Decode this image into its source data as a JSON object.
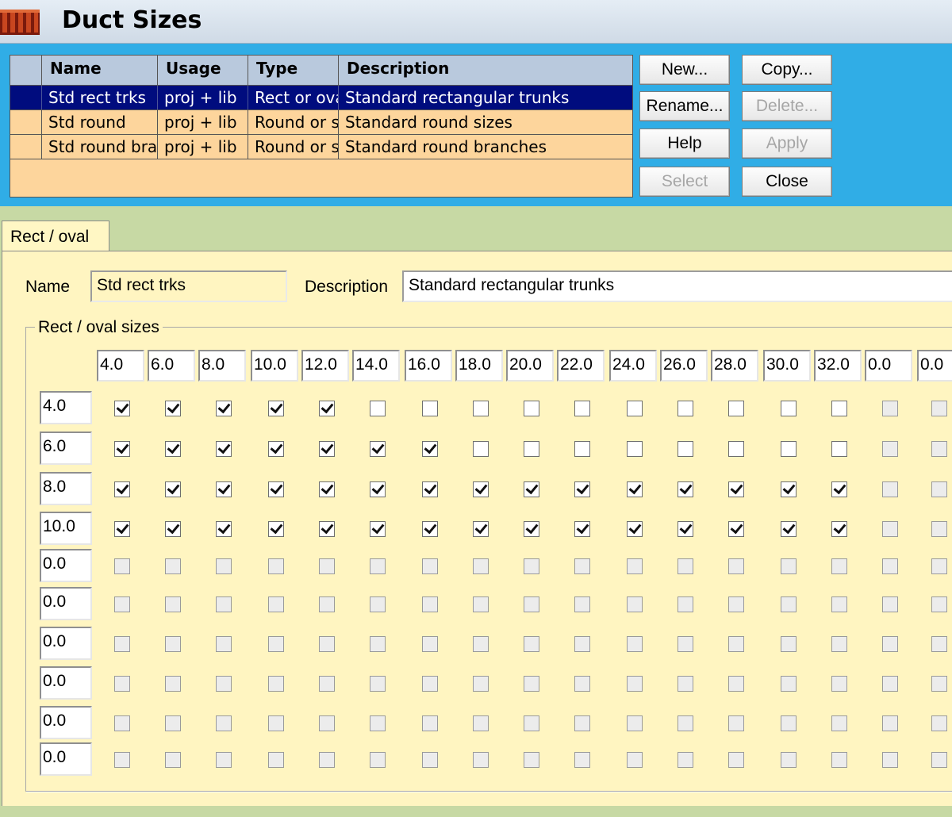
{
  "window": {
    "title": "Duct Sizes"
  },
  "table": {
    "headers": [
      "Name",
      "Usage",
      "Type",
      "Description"
    ],
    "rows": [
      {
        "name": "Std rect trks",
        "usage": "proj + lib",
        "type": "Rect or oval",
        "description": "Standard rectangular trunks",
        "selected": true
      },
      {
        "name": "Std round",
        "usage": "proj + lib",
        "type": "Round or s",
        "description": "Standard round sizes",
        "selected": false
      },
      {
        "name": "Std round bran",
        "usage": "proj + lib",
        "type": "Round or s",
        "description": "Standard round branches",
        "selected": false
      }
    ]
  },
  "buttons": {
    "new": "New...",
    "copy": "Copy...",
    "rename": "Rename...",
    "delete": "Delete...",
    "help": "Help",
    "apply": "Apply",
    "select": "Select",
    "close": "Close"
  },
  "tab": {
    "label": "Rect / oval"
  },
  "form": {
    "name_label": "Name",
    "name_value": "Std rect trks",
    "description_label": "Description",
    "description_value": "Standard rectangular trunks"
  },
  "sizes": {
    "group_label": "Rect / oval sizes",
    "widths": [
      "4.0",
      "6.0",
      "8.0",
      "10.0",
      "12.0",
      "14.0",
      "16.0",
      "18.0",
      "20.0",
      "22.0",
      "24.0",
      "26.0",
      "28.0",
      "30.0",
      "32.0",
      "0.0",
      "0.0"
    ],
    "heights": [
      "4.0",
      "6.0",
      "8.0",
      "10.0",
      "0.0",
      "0.0",
      "0.0",
      "0.0",
      "0.0",
      "0.0"
    ],
    "matrix": [
      [
        1,
        1,
        1,
        1,
        1,
        0,
        0,
        0,
        0,
        0,
        0,
        0,
        0,
        0,
        0,
        0,
        0
      ],
      [
        1,
        1,
        1,
        1,
        1,
        1,
        1,
        0,
        0,
        0,
        0,
        0,
        0,
        0,
        0,
        0,
        0
      ],
      [
        1,
        1,
        1,
        1,
        1,
        1,
        1,
        1,
        1,
        1,
        1,
        1,
        1,
        1,
        1,
        0,
        0
      ],
      [
        1,
        1,
        1,
        1,
        1,
        1,
        1,
        1,
        1,
        1,
        1,
        1,
        1,
        1,
        1,
        0,
        0
      ],
      [
        0,
        0,
        0,
        0,
        0,
        0,
        0,
        0,
        0,
        0,
        0,
        0,
        0,
        0,
        0,
        0,
        0
      ],
      [
        0,
        0,
        0,
        0,
        0,
        0,
        0,
        0,
        0,
        0,
        0,
        0,
        0,
        0,
        0,
        0,
        0
      ],
      [
        0,
        0,
        0,
        0,
        0,
        0,
        0,
        0,
        0,
        0,
        0,
        0,
        0,
        0,
        0,
        0,
        0
      ],
      [
        0,
        0,
        0,
        0,
        0,
        0,
        0,
        0,
        0,
        0,
        0,
        0,
        0,
        0,
        0,
        0,
        0
      ],
      [
        0,
        0,
        0,
        0,
        0,
        0,
        0,
        0,
        0,
        0,
        0,
        0,
        0,
        0,
        0,
        0,
        0
      ],
      [
        0,
        0,
        0,
        0,
        0,
        0,
        0,
        0,
        0,
        0,
        0,
        0,
        0,
        0,
        0,
        0,
        0
      ]
    ]
  }
}
